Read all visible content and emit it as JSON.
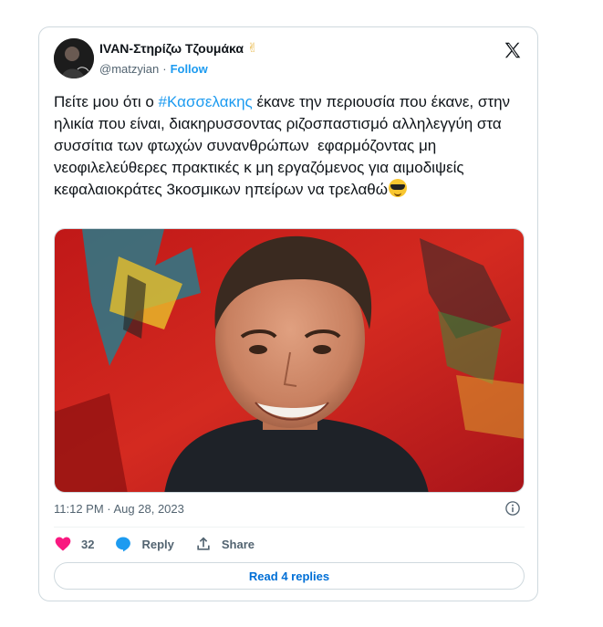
{
  "author": {
    "display_name": "IVAN-Στηρίζω Τζουμάκα",
    "name_emoji": "✌",
    "handle": "@matzyian",
    "separator": "·",
    "follow_label": "Follow"
  },
  "tweet": {
    "text_before_hashtag": "Πείτε μου ότι ο ",
    "hashtag": "#Κασσελακης",
    "text_after_hashtag": " έκανε την περιουσία που έκανε, στην ηλικία που είναι, διακηρυσσοντας ριζοσπαστισμό αλληλεγγύη στα συσσίτια των φτωχών συνανθρώπων  εφαρμόζοντας μη νεοφιλελεύθερες πρακτικές κ μη εργαζόμενος για αιμοδιψείς κεφαλαιοκράτες 3κοσμικων ηπείρων να τρελαθώ",
    "trailing_emoji": "smiling-face-with-sunglasses",
    "timestamp": "11:12 PM · Aug 28, 2023"
  },
  "actions": {
    "like_count": "32",
    "reply_label": "Reply",
    "share_label": "Share"
  },
  "read_replies_label": "Read 4 replies",
  "colors": {
    "accent": "#1d9bf0",
    "like": "#f91880",
    "text": "#0f1419",
    "muted": "#536471",
    "border": "#cfd9de"
  }
}
